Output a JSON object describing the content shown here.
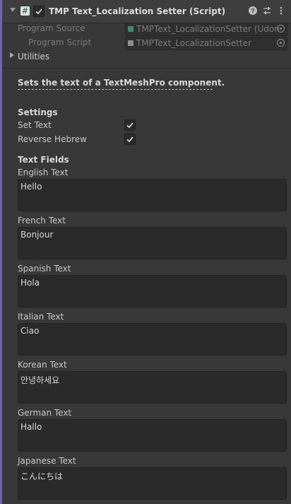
{
  "header": {
    "title": "TMP Text_Localization Setter (Script)",
    "enabled": true
  },
  "fields": {
    "program_source": {
      "label": "Program Source",
      "value": "TMPText_LocalizationSetter (Udon"
    },
    "program_script": {
      "label": "Program Script",
      "value": "TMPText_LocalizationSetter"
    }
  },
  "utilities_label": "Utilities",
  "description": "Sets the text of a TextMeshPro component.",
  "settings": {
    "heading": "Settings",
    "set_text": {
      "label": "Set Text",
      "checked": true
    },
    "reverse_hebrew": {
      "label": "Reverse Hebrew",
      "checked": true
    }
  },
  "text_fields": {
    "heading": "Text Fields",
    "items": [
      {
        "label": "English Text",
        "value": "Hello"
      },
      {
        "label": "French Text",
        "value": "Bonjour"
      },
      {
        "label": "Spanish Text",
        "value": "Hola"
      },
      {
        "label": "Italian Text",
        "value": "Ciao"
      },
      {
        "label": "Korean Text",
        "value": "안녕하세요"
      },
      {
        "label": "German Text",
        "value": "Hallo"
      },
      {
        "label": "Japanese Text",
        "value": "こんにちは"
      }
    ]
  },
  "icons": [
    "collapse-arrow-icon",
    "script-hash-icon",
    "checkbox-icon",
    "help-icon",
    "presets-icon",
    "more-menu-icon",
    "object-picker-icon",
    "expand-arrow-icon"
  ],
  "colors": {
    "accent": "#6f63b3",
    "script_icon": "#2b8f3e",
    "udon_asset_icon": "#3f8a7a"
  }
}
